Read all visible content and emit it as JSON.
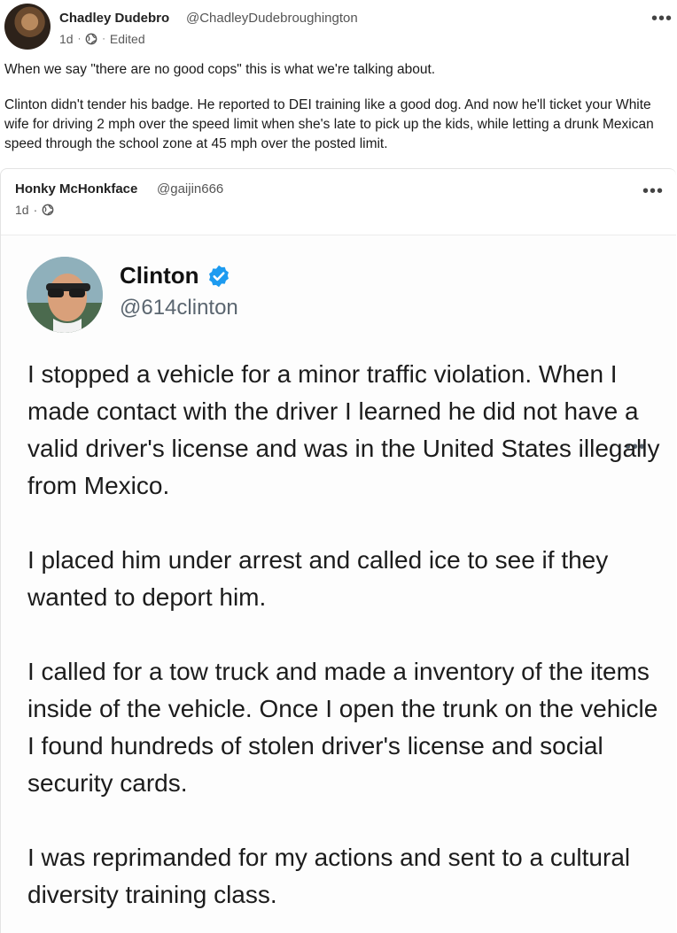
{
  "post": {
    "author_name": "Chadley Dudebro",
    "author_handle": "@ChadleyDudebroughington",
    "time": "1d",
    "edited_label": "Edited",
    "more_label": "•••",
    "paragraph_1": "When we say \"there are no good cops\" this is what we're talking about.",
    "paragraph_2": "Clinton didn't tender his badge. He reported to DEI training like a good dog. And now he'll ticket your White wife for driving 2 mph over the speed limit when she's late to pick up the kids, while letting a drunk Mexican speed through the school zone at 45 mph over the posted limit."
  },
  "quote": {
    "author_name": "Honky McHonkface",
    "author_handle": "@gaijin666",
    "time": "1d",
    "more_label": "•••"
  },
  "tweet": {
    "name": "Clinton",
    "handle": "@614clinton",
    "more_label": "•••",
    "paragraphs": [
      "I stopped a vehicle for a minor traffic violation. When I made contact with the driver I learned he did not have a valid driver's license and was in the United States illegally from Mexico.",
      "I placed him under arrest and called ice to see if they wanted to deport him.",
      "I called for a tow truck and made a inventory of the items inside of the vehicle. Once I open the trunk on the vehicle I found hundreds of stolen driver's license and social security cards.",
      "I was reprimanded for my actions and sent to a cultural diversity training class."
    ]
  },
  "icons": {
    "globe": "globe-icon",
    "verified": "verified-badge-icon",
    "more": "more-options-icon"
  },
  "colors": {
    "verified_blue": "#1d9bf0",
    "handle_gray": "#5b6670"
  }
}
